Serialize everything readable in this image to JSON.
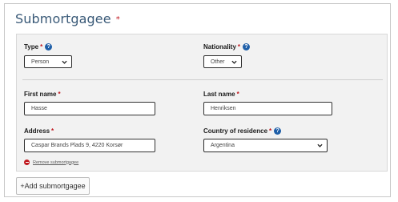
{
  "section": {
    "title": "Submortgagee",
    "required_marker": "*"
  },
  "form": {
    "type": {
      "label": "Type",
      "required": "*",
      "help": "?",
      "value": "Person"
    },
    "nationality": {
      "label": "Nationality",
      "required": "*",
      "help": "?",
      "value": "Other"
    },
    "first_name": {
      "label": "First name",
      "required": "*",
      "value": "Hasse"
    },
    "last_name": {
      "label": "Last name",
      "required": "*",
      "value": "Henriksen"
    },
    "address": {
      "label": "Address",
      "required": "*",
      "value": "Caspar Brands Plads 9, 4220 Korsør"
    },
    "country": {
      "label": "Country of residence",
      "required": "*",
      "help": "?",
      "value": "Argentina"
    },
    "remove_link": "Remove submortgagee"
  },
  "actions": {
    "add_label": "+Add submortgagee"
  },
  "colors": {
    "title": "#3a5a78",
    "required": "#c0181f",
    "help_icon": "#1f5fa8",
    "panel_bg": "#f2f2f2"
  },
  "icons": {
    "help": "question-circle-icon",
    "dropdown": "chevron-down-icon",
    "remove": "minus-circle-icon"
  }
}
